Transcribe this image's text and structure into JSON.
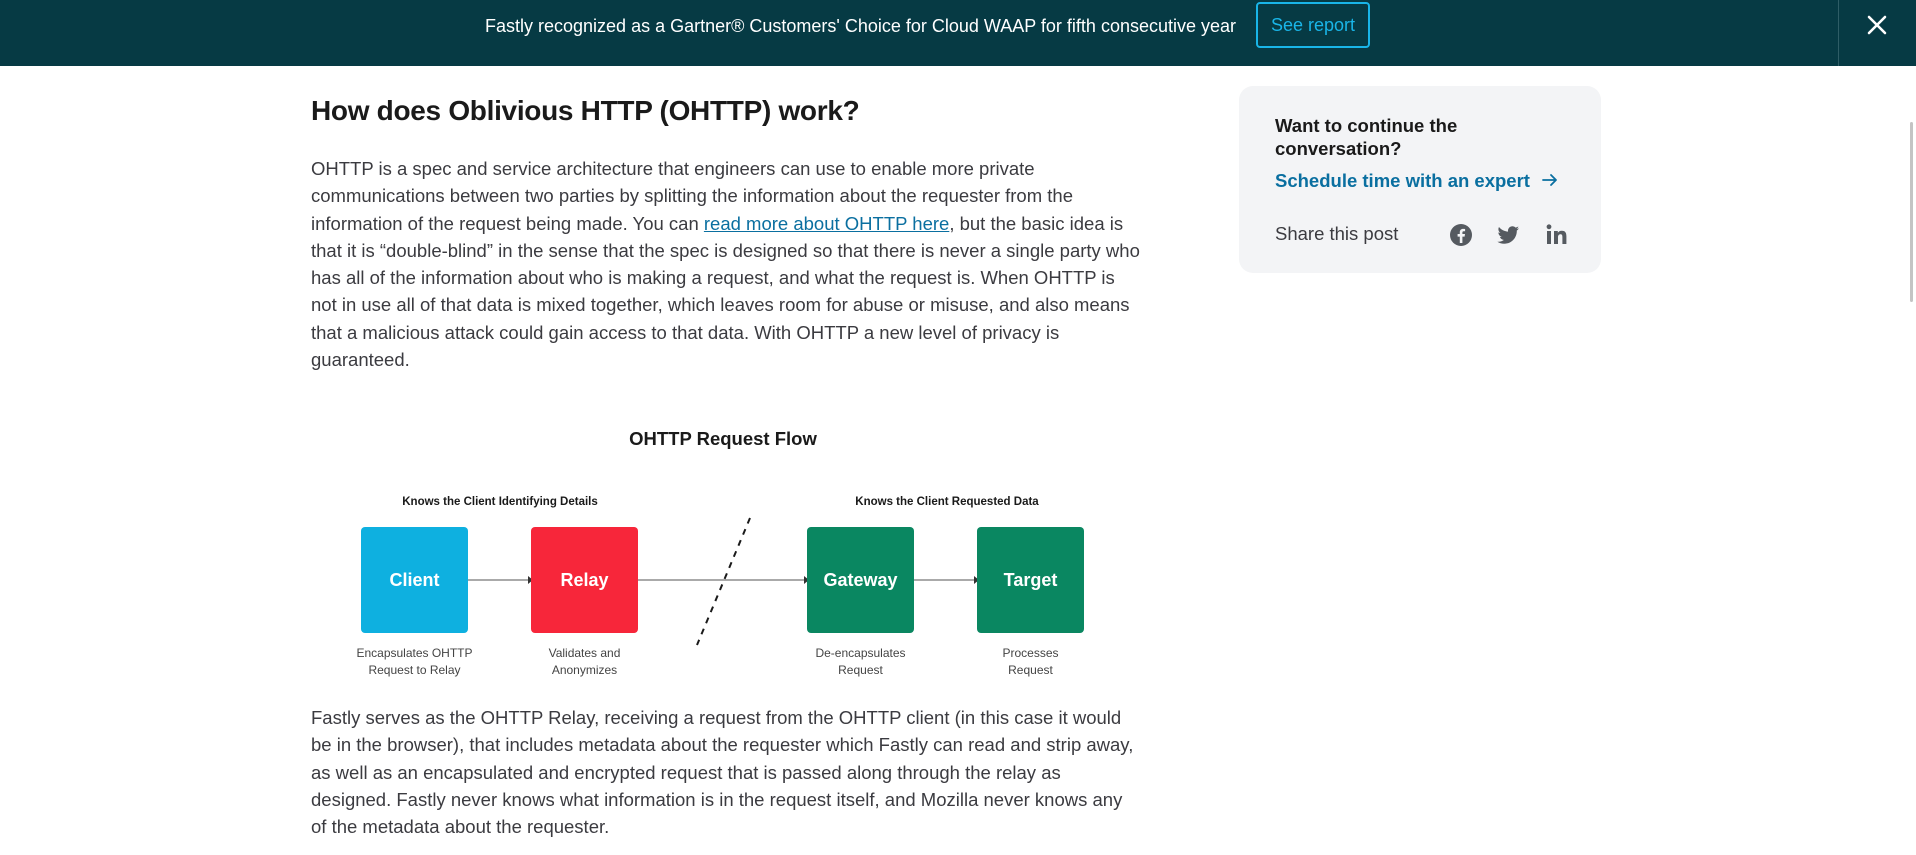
{
  "banner": {
    "text": "Fastly recognized as a Gartner® Customers' Choice for Cloud WAAP for fifth consecutive year",
    "button_label": "See report",
    "close_icon": "close-icon"
  },
  "article": {
    "heading": "How does Oblivious HTTP (OHTTP) work?",
    "para1_before": "OHTTP is a spec and service architecture that engineers can use to enable more private communications between two parties by splitting the information about the requester from the information of the request being made. You can ",
    "para1_link": "read more about OHTTP here",
    "para1_after": ", but the basic idea is that it is “double-blind” in the sense that the spec is designed so that there is never a single party who has all of the information about who is making a request, and what the request is. When OHTTP is not in use all of that data is mixed together, which leaves room for abuse or misuse, and also means that a malicious attack could gain access to that data. With OHTTP a new level of privacy is guaranteed.",
    "para2": "Fastly serves as the OHTTP Relay, receiving a request from the OHTTP client (in this case it would be in the browser), that includes metadata about the requester which Fastly can read and strip away, as well as an encapsulated and encrypted request that is passed along through the relay as designed. Fastly never knows what information is in the request itself, and Mozilla never knows any of the metadata about the requester."
  },
  "diagram": {
    "title": "OHTTP Request Flow",
    "group_left": "Knows the Client Identifying Details",
    "group_right": "Knows the Client Requested Data",
    "nodes": [
      {
        "label": "Client",
        "caption1": "Encapsulates OHTTP",
        "caption2": "Request to Relay",
        "color": "#0eb0e0"
      },
      {
        "label": "Relay",
        "caption1": "Validates and",
        "caption2": "Anonymizes",
        "color": "#f7263a"
      },
      {
        "label": "Gateway",
        "caption1": "De-encapsulates",
        "caption2": "Request",
        "color": "#0a8761"
      },
      {
        "label": "Target",
        "caption1": "Processes",
        "caption2": "Request",
        "color": "#0a8761"
      }
    ]
  },
  "sidebar": {
    "title": "Want to continue the conversation?",
    "link": "Schedule time with an expert",
    "share_label": "Share this post",
    "icons": [
      "facebook-icon",
      "twitter-icon",
      "linkedin-icon"
    ]
  }
}
